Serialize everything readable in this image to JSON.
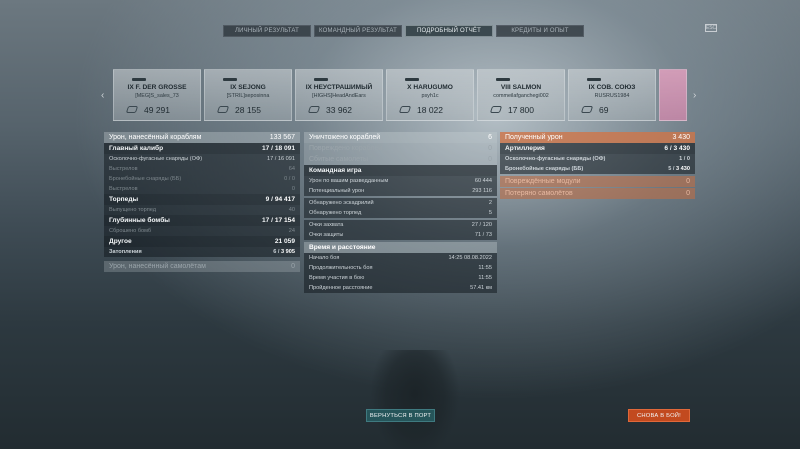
{
  "tabs": [
    "ЛИЧНЫЙ РЕЗУЛЬТАТ",
    "КОМАНДНЫЙ РЕЗУЛЬТАТ",
    "ПОДРОБНЫЙ ОТЧЁТ",
    "КРЕДИТЫ И ОПЫТ"
  ],
  "active_tab": "ПОДРОБНЫЙ ОТЧЁТ",
  "corner_icon": "esc-icon",
  "corner_icon_text": "ESC",
  "nav": {
    "left": "‹",
    "right": "›"
  },
  "ships": [
    {
      "name": "IX F. DER GROSSE",
      "player": "[MEG]S_sales_73",
      "damage": "49 291"
    },
    {
      "name": "IX SEJONG",
      "player": "[STRIL]seposinna",
      "damage": "28 155"
    },
    {
      "name": "IX НЕУСТРАШИМЫЙ",
      "player": "[HIGHS]HeadAndEars",
      "damage": "33 962"
    },
    {
      "name": "X HARUGUMO",
      "player": "psyh1c",
      "damage": "18 022"
    },
    {
      "name": "VIII SALMON",
      "player": "commeilafganchegi002",
      "damage": "17 800"
    },
    {
      "name": "IX СОВ. СОЮЗ",
      "player": "RUSRUS1984",
      "damage": "69"
    }
  ],
  "left_panel": {
    "damage_title": "Урон, нанесённый кораблям",
    "damage_total": "133 567",
    "main_battery": "Главный калибр",
    "main_battery_val": "17 / 18 091",
    "he_shells": "Осколочно-фугасные снаряды (ОФ)",
    "he_shells_val": "17 / 16 091",
    "he_shots": "Выстрелов",
    "he_shots_val": "64",
    "ap_shells": "Бронебойные снаряды (ББ)",
    "ap_shells_val": "0 / 0",
    "ap_shots": "Выстрелов",
    "ap_shots_val": "0",
    "torpedoes": "Торпеды",
    "torpedoes_hits": "9",
    "torpedoes_dmg": "94 417",
    "torpedoes_fired": "Выпущено торпед",
    "torpedoes_fired_val": "40",
    "depth_charges": "Глубинные бомбы",
    "depth_charges_hits": "17",
    "depth_charges_dmg": "17 154",
    "depth_dropped": "Сброшено бомб",
    "depth_dropped_val": "24",
    "other": "Другое",
    "other_val": "21 059",
    "flooding": "Затопления",
    "flooding_hits": "6",
    "flooding_dmg": "3 905",
    "aircraft_damage": "Урон, нанесённый самолётам",
    "aircraft_damage_val": "0"
  },
  "middle_panel": {
    "ships_destroyed": "Уничтожено кораблей",
    "ships_destroyed_val": "6",
    "modules_damaged": "Повреждено кораблей",
    "modules_damaged_val": "0",
    "planes_shot": "Сбитые самолеты",
    "planes_shot_val": "0",
    "team_play": "Командная игра",
    "spotting_damage": "Урон по вашим разведданным",
    "spotting_damage_val": "60 444",
    "potential_damage": "Потенциальный урон",
    "potential_damage_val": "293 116",
    "destroyers_spotted": "Обнаружено эскадрилий",
    "destroyers_spotted_val": "2",
    "torpedoes_spotted": "Обнаружено торпед",
    "torpedoes_spotted_val": "5",
    "capture_points": "Очки захвата",
    "capture_points_val": "27 / 120",
    "defense_points": "Очки защиты",
    "defense_points_val": "71 / 73",
    "time_distance": "Время и расстояние",
    "battle_start": "Начало боя",
    "battle_start_val": "14:25   08.08.2022",
    "battle_duration": "Продолжительность боя",
    "battle_duration_val": "11:55",
    "participation_time": "Время участия в бою",
    "participation_time_val": "11:55",
    "distance": "Пройденное расстояние",
    "distance_val": "57.41 км"
  },
  "right_panel": {
    "received_damage": "Полученный урон",
    "received_damage_val": "3 430",
    "artillery": "Артиллерия",
    "artillery_hits": "6",
    "artillery_dmg": "3 430",
    "he_received": "Осколочно-фугасные снаряды (ОФ)",
    "he_received_val": "1 / 0",
    "ap_received": "Бронебойные снаряды (ББ)",
    "ap_received_hits": "5",
    "ap_received_dmg": "3 430",
    "damaged_modules": "Повреждённые модули",
    "damaged_modules_val": "0",
    "planes_lost": "Потеряно самолётов",
    "planes_lost_val": "0"
  },
  "buttons": {
    "to_port": "ВЕРНУТЬСЯ В ПОРТ",
    "battle_again": "СНОВА В БОЙ!"
  },
  "colors": {
    "orange": "#d07648",
    "teal_button": "#26555a",
    "red_button": "#c24a1f"
  }
}
